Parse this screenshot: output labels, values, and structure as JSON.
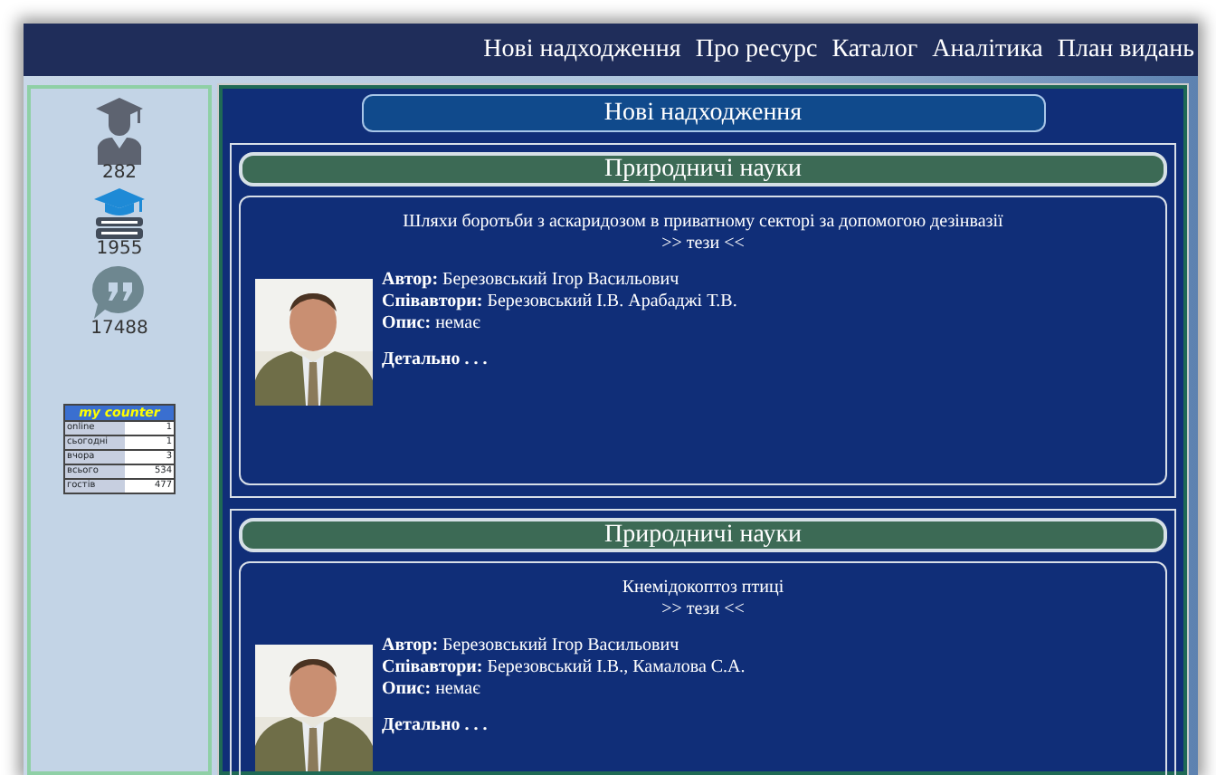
{
  "nav": [
    "Нові надходження",
    "Про ресурс",
    "Каталог",
    "Аналітика",
    "План видань"
  ],
  "sidebar": {
    "stats": [
      {
        "kind": "authors",
        "value": "282"
      },
      {
        "kind": "works",
        "value": "1955"
      },
      {
        "kind": "reviews",
        "value": "17488"
      }
    ],
    "counter": {
      "title": "my counter",
      "rows": [
        {
          "label": "online",
          "value": "1"
        },
        {
          "label": "сьогодні",
          "value": "1"
        },
        {
          "label": "вчора",
          "value": "3"
        },
        {
          "label": "всього",
          "value": "534"
        },
        {
          "label": "гостів",
          "value": "477"
        }
      ]
    }
  },
  "section_title": "Нові надходження",
  "entries": [
    {
      "category": "Природничі науки",
      "title": "Шляхи боротьби з аскаридозом в приватному секторі за допомогою дезінвазії",
      "abstract_link": ">> тези <<",
      "fields": [
        {
          "label": "Автор:",
          "value": "Березовський Ігор Васильович"
        },
        {
          "label": "Співавтори:",
          "value": "Березовський І.В. Арабаджі Т.В."
        },
        {
          "label": "Опис:",
          "value": "немає"
        }
      ],
      "more": "Детально . . ."
    },
    {
      "category": "Природничі науки",
      "title": "Кнемідокоптоз птиці",
      "abstract_link": ">> тези <<",
      "fields": [
        {
          "label": "Автор:",
          "value": "Березовський Ігор Васильович"
        },
        {
          "label": "Співавтори:",
          "value": "Березовський І.В., Камалова С.А."
        },
        {
          "label": "Опис:",
          "value": "немає"
        }
      ],
      "more": "Детально . . ."
    }
  ]
}
